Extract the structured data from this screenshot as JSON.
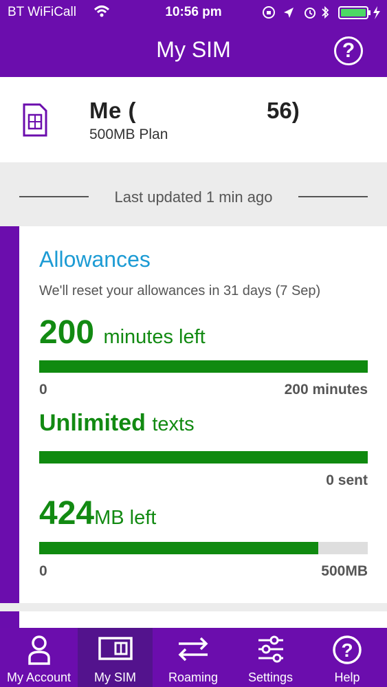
{
  "status_bar": {
    "carrier": "BT WiFiCall",
    "time": "10:56 pm",
    "icons": [
      "wifi-icon",
      "screen-rotation-lock-icon",
      "location-icon",
      "alarm-icon",
      "bluetooth-icon",
      "battery-charging-icon"
    ]
  },
  "header": {
    "title": "My SIM",
    "help": "?"
  },
  "profile": {
    "name": "Me (",
    "number_fragment": "56)",
    "plan": "500MB Plan"
  },
  "updated": {
    "text": "Last updated 1 min ago"
  },
  "allowances": {
    "title": "Allowances",
    "reset_note": "We'll reset your allowances in 31 days (7 Sep)",
    "minutes": {
      "value": "200",
      "suffix": "minutes left",
      "min_label": "0",
      "max_label": "200 minutes",
      "fill_percent": 100
    },
    "texts": {
      "value": "Unlimited",
      "suffix": "texts",
      "sent_label": "0 sent",
      "fill_percent": 100
    },
    "data": {
      "value": "424",
      "suffix": "MB left",
      "min_label": "0",
      "max_label": "500MB",
      "fill_percent": 85
    }
  },
  "colors": {
    "brand": "#6b0dad",
    "accent_blue": "#1c9bd4",
    "green": "#128a12"
  },
  "tabs": [
    {
      "label": "My Account",
      "icon": "person-icon"
    },
    {
      "label": "My SIM",
      "icon": "sim-card-icon"
    },
    {
      "label": "Roaming",
      "icon": "arrows-swap-icon"
    },
    {
      "label": "Settings",
      "icon": "sliders-icon"
    },
    {
      "label": "Help",
      "icon": "help-circle-icon"
    }
  ]
}
